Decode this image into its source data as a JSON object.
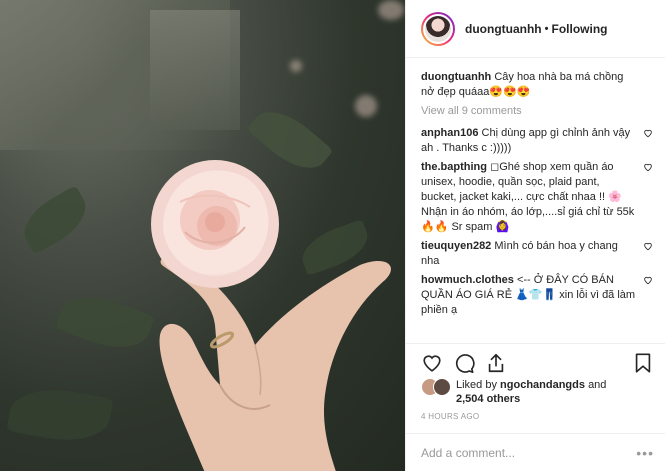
{
  "header": {
    "username": "duongtuanhh",
    "separator": "•",
    "follow_status": "Following"
  },
  "caption": {
    "username": "duongtuanhh",
    "text": "Cây hoa nhà ba má chồng nở đẹp quáaa😍😍😍"
  },
  "view_all_comments": "View all 9 comments",
  "comments": [
    {
      "username": "anphan106",
      "text": "Chị dùng app gì chỉnh ảnh vậy ah . Thanks c :)))))"
    },
    {
      "username": "the.bapthing",
      "text": "◻Ghé shop xem quần áo unisex, hoodie, quần sọc, plaid pant, bucket, jacket kaki,... cực chất nhaa !! 🌸Nhận in áo nhóm, áo lớp,....sỉ giá chỉ từ 55k 🔥🔥 Sr spam 🙆‍♀️"
    },
    {
      "username": "tieuquyen282",
      "text": "Mình có bán hoa y chang nha"
    },
    {
      "username": "howmuch.clothes",
      "text": "<-- Ở ĐÂY CÓ BÁN QUẦN ÁO GIÁ RẺ 👗👕👖 xin lỗi vì đã làm phiền ạ"
    }
  ],
  "likes": {
    "prefix": "Liked by",
    "user": "ngochandangds",
    "and": "and",
    "count": "2,504 others"
  },
  "timestamp": "4 HOURS AGO",
  "add_comment_placeholder": "Add a comment...",
  "more_options": "•••",
  "icons": {
    "like": "heart-icon",
    "comment": "comment-icon",
    "share": "share-icon",
    "save": "bookmark-icon"
  },
  "colors": {
    "text": "#262626",
    "muted": "#999999",
    "border": "#efefef"
  }
}
